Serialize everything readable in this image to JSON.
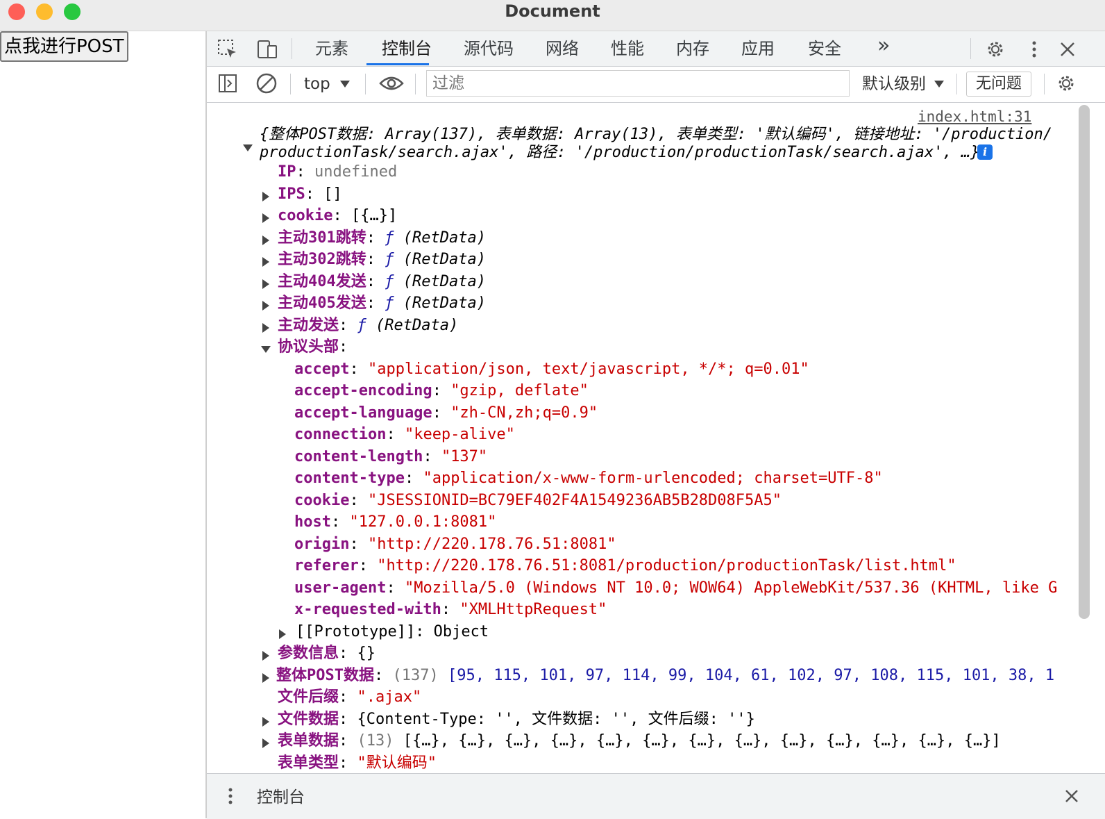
{
  "window": {
    "title": "Document"
  },
  "page": {
    "post_button": "点我进行POST"
  },
  "devtools": {
    "tabs": [
      "元素",
      "控制台",
      "源代码",
      "网络",
      "性能",
      "内存",
      "应用",
      "安全"
    ],
    "more_tabs": "»",
    "toolbar": {
      "context": "top",
      "filter_placeholder": "过滤",
      "levels": "默认级别",
      "issues": "无问题"
    },
    "drawer_title": "控制台",
    "console": {
      "source": "index.html:31",
      "summary_line1": "{整体POST数据: Array(137), 表单数据: Array(13), 表单类型: '默认编码', 链接地址: '/production/",
      "summary_line2": "productionTask/search.ajax', 路径: '/production/productionTask/search.ajax', …}",
      "ip_key": "IP",
      "ip_val": "undefined",
      "ips_key": "IPS",
      "ips_val": "[]",
      "cookie_key": "cookie",
      "cookie_val": "[{…}]",
      "f301_key": "主动301跳转",
      "f302_key": "主动302跳转",
      "f404_key": "主动404发送",
      "f405_key": "主动405发送",
      "fsend_key": "主动发送",
      "fn_sym": "ƒ",
      "fn_args": "(RetData)",
      "headers_key": "协议头部",
      "headers": [
        {
          "k": "accept",
          "v": "\"application/json, text/javascript, */*; q=0.01\""
        },
        {
          "k": "accept-encoding",
          "v": "\"gzip, deflate\""
        },
        {
          "k": "accept-language",
          "v": "\"zh-CN,zh;q=0.9\""
        },
        {
          "k": "connection",
          "v": "\"keep-alive\""
        },
        {
          "k": "content-length",
          "v": "\"137\""
        },
        {
          "k": "content-type",
          "v": "\"application/x-www-form-urlencoded; charset=UTF-8\""
        },
        {
          "k": "cookie",
          "v": "\"JSESSIONID=BC79EF402F4A1549236AB5B28D08F5A5\""
        },
        {
          "k": "host",
          "v": "\"127.0.0.1:8081\""
        },
        {
          "k": "origin",
          "v": "\"http://220.178.76.51:8081\""
        },
        {
          "k": "referer",
          "v": "\"http://220.178.76.51:8081/production/productionTask/list.html\""
        },
        {
          "k": "user-agent",
          "v": "\"Mozilla/5.0 (Windows NT 10.0; WOW64) AppleWebKit/537.36 (KHTML, like G"
        },
        {
          "k": "x-requested-with",
          "v": "\"XMLHttpRequest\""
        }
      ],
      "proto": "[[Prototype]]: Object",
      "params_key": "参数信息",
      "params_val": "{}",
      "post_key": "整体POST数据",
      "post_count": "(137)",
      "post_vals": "[95, 115, 101, 97, 114, 99, 104, 61, 102, 97, 108, 115, 101, 38, 1",
      "ext_key": "文件后缀",
      "ext_val": "\".ajax\"",
      "filedata_key": "文件数据",
      "filedata_val": "{Content-Type: '', 文件数据: '', 文件后缀: ''}",
      "form_key": "表单数据",
      "form_count": "(13)",
      "form_val": "[{…}, {…}, {…}, {…}, {…}, {…}, {…}, {…}, {…}, {…}, {…}, {…}, {…}]",
      "formtype_key": "表单类型",
      "formtype_val": "\"默认编码\""
    }
  }
}
